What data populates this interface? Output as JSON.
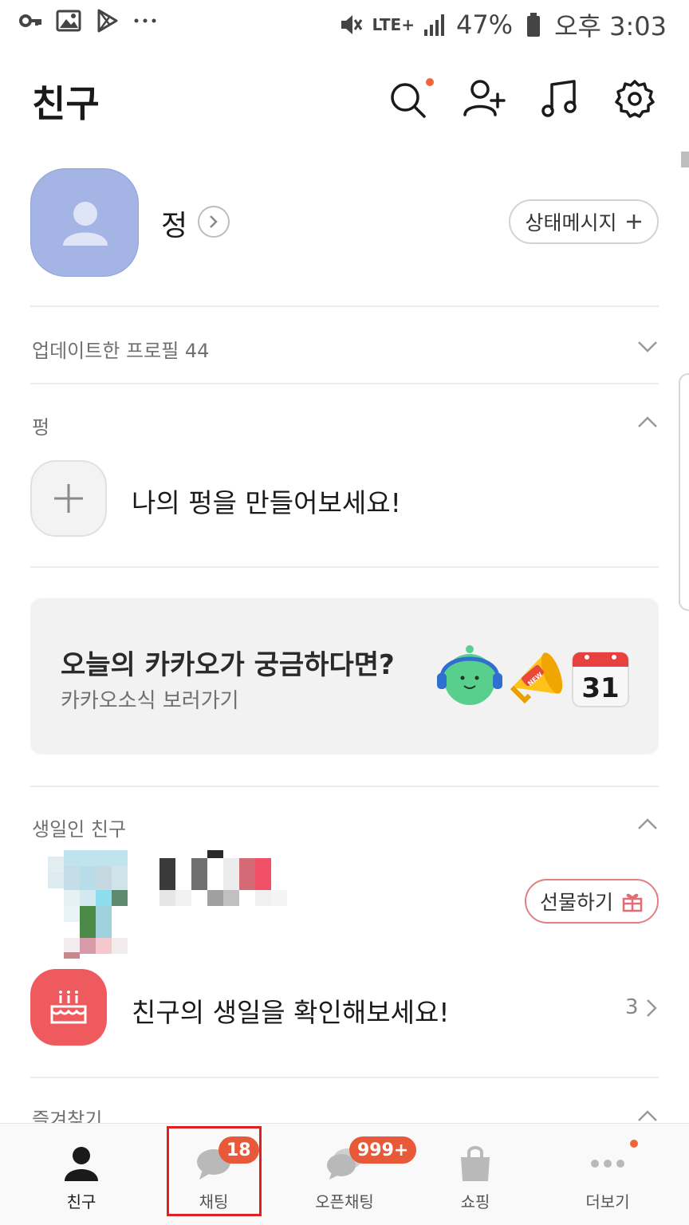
{
  "status_bar": {
    "network": "LTE+",
    "battery": "47%",
    "time": "오후 3:03"
  },
  "header": {
    "title": "친구",
    "icons": [
      "search-icon",
      "add-friend-icon",
      "music-icon",
      "settings-icon"
    ]
  },
  "profile": {
    "name": "정",
    "status_button_label": "상태메시지"
  },
  "sections": {
    "updated_profiles": "업데이트한 프로필 44",
    "pung_label": "펑",
    "pung_cta": "나의 펑을 만들어보세요!",
    "birthday_label": "생일인 친구",
    "favorites_label": "즐겨찾기"
  },
  "banner": {
    "title": "오늘의 카카오가 궁금하다면?",
    "subtitle": "카카오소식 보러가기",
    "calendar_number": "31",
    "badge_text": "NEW"
  },
  "birthday": {
    "gift_button_label": "선물하기",
    "cta": "친구의 생일을 확인해보세요!",
    "count": "3"
  },
  "bottom_nav": {
    "tabs": [
      {
        "label": "친구",
        "icon": "person-icon"
      },
      {
        "label": "채팅",
        "icon": "chat-icon",
        "badge": "18"
      },
      {
        "label": "오픈채팅",
        "icon": "open-chat-icon",
        "badge": "999+"
      },
      {
        "label": "쇼핑",
        "icon": "shopping-bag-icon"
      },
      {
        "label": "더보기",
        "icon": "more-icon"
      }
    ]
  },
  "colors": {
    "accent": "#e8593a",
    "highlight": "#e02020",
    "avatar": "#a3b4e5",
    "birthday": "#ee5a5e"
  }
}
